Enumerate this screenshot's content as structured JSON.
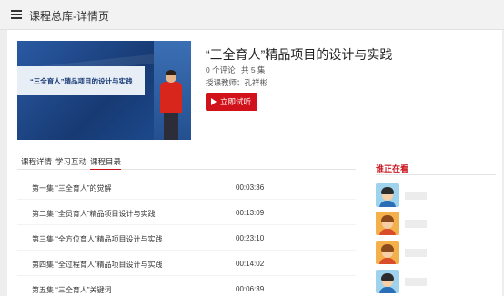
{
  "header": {
    "title": "课程总库-详情页"
  },
  "course": {
    "thumbnail_text": "“三全育人”精品项目的设计与实践",
    "title": "“三全育人”精品项目的设计与实践",
    "comments": "0 个评论",
    "episodes": "共 5 集",
    "teacher": "授课教师：孔祥彬",
    "try_button": "立即试听"
  },
  "tabs": [
    {
      "label": "课程详情",
      "active": false
    },
    {
      "label": "学习互动",
      "active": false
    },
    {
      "label": "课程目录",
      "active": true
    }
  ],
  "lessons": [
    {
      "name": "第一集 “三全育人”的觉解",
      "duration": "00:03:36"
    },
    {
      "name": "第二集 “全员育人”精品项目设计与实践",
      "duration": "00:13:09"
    },
    {
      "name": "第三集 “全方位育人”精品项目设计与实践",
      "duration": "00:23:10"
    },
    {
      "name": "第四集 “全过程育人”精品项目设计与实践",
      "duration": "00:14:02"
    },
    {
      "name": "第五集 “三全育人”关键词",
      "duration": "00:06:39"
    }
  ],
  "watching": {
    "title": "谁正在看",
    "viewers": [
      {
        "avatar": "boy-avatar-icon"
      },
      {
        "avatar": "girl-avatar-icon"
      },
      {
        "avatar": "girl-avatar-icon"
      },
      {
        "avatar": "boy-avatar-icon"
      }
    ]
  },
  "colors": {
    "accent": "#c9151e",
    "button": "#d1121b"
  }
}
